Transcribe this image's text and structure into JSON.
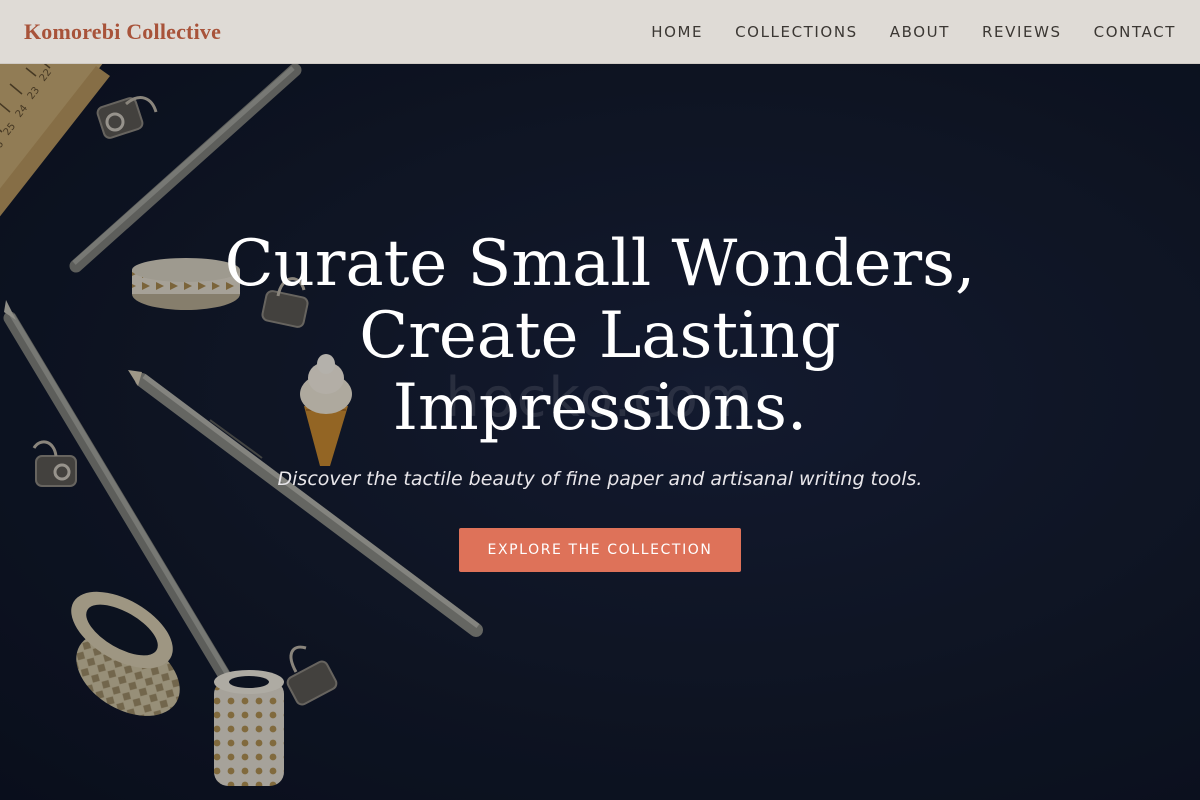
{
  "header": {
    "brand": "Komorebi Collective",
    "nav": [
      {
        "label": "HOME"
      },
      {
        "label": "COLLECTIONS"
      },
      {
        "label": "ABOUT"
      },
      {
        "label": "REVIEWS"
      },
      {
        "label": "CONTACT"
      }
    ]
  },
  "hero": {
    "headline_lines": [
      "Curate Small Wonders,",
      "Create Lasting",
      "Impressions."
    ],
    "subtitle": "Discover the tactile beauty of fine paper and artisanal writing tools.",
    "cta_label": "EXPLORE THE COLLECTION",
    "watermark": "hocko.com",
    "ruler_marks": [
      "22",
      "23",
      "24",
      "25",
      "26"
    ]
  },
  "colors": {
    "brand": "#a8533a",
    "header_bg": "#dfdbd6",
    "hero_bg": "#111829",
    "cta_bg": "#de7259"
  }
}
